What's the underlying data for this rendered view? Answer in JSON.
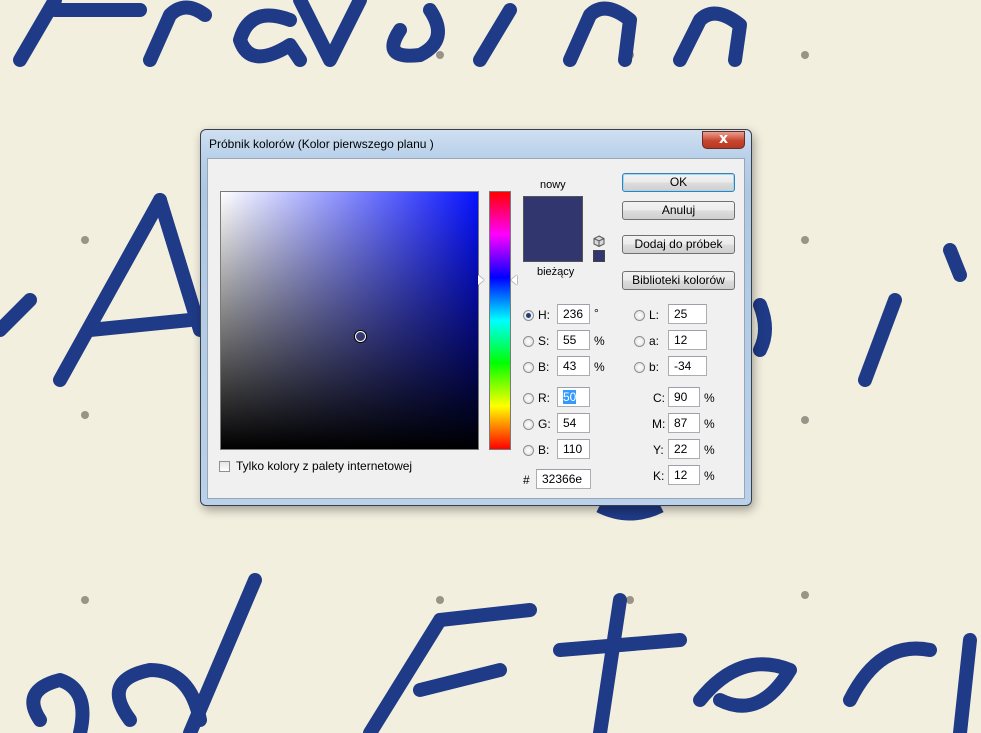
{
  "window": {
    "title": "Próbnik kolorów (Kolor pierwszego planu )",
    "close_glyph": "x"
  },
  "colors": {
    "new": "#32366e",
    "current": "#32366e",
    "field_hue": "#0712ff"
  },
  "swatches": {
    "new_label": "nowy",
    "current_label": "bieżący"
  },
  "buttons": {
    "ok": "OK",
    "cancel": "Anuluj",
    "add_to_swatches": "Dodaj do próbek",
    "color_libraries": "Biblioteki kolorów"
  },
  "web_colors_only": {
    "label": "Tylko kolory z palety internetowej",
    "checked": false
  },
  "hsb": {
    "h": {
      "label": "H:",
      "value": "236",
      "unit": "°",
      "selected": true
    },
    "s": {
      "label": "S:",
      "value": "55",
      "unit": "%",
      "selected": false
    },
    "b": {
      "label": "B:",
      "value": "43",
      "unit": "%",
      "selected": false
    }
  },
  "rgb": {
    "r": {
      "label": "R:",
      "value": "50",
      "selected": false
    },
    "g": {
      "label": "G:",
      "value": "54",
      "selected": false
    },
    "b": {
      "label": "B:",
      "value": "110",
      "selected": false
    }
  },
  "lab": {
    "l": {
      "label": "L:",
      "value": "25",
      "selected": false
    },
    "a": {
      "label": "a:",
      "value": "12",
      "selected": false
    },
    "b": {
      "label": "b:",
      "value": "-34",
      "selected": false
    }
  },
  "cmyk": {
    "c": {
      "label": "C:",
      "value": "90",
      "unit": "%"
    },
    "m": {
      "label": "M:",
      "value": "87",
      "unit": "%"
    },
    "y": {
      "label": "Y:",
      "value": "22",
      "unit": "%"
    },
    "k": {
      "label": "K:",
      "value": "12",
      "unit": "%"
    }
  },
  "hex": {
    "label": "#",
    "value": "32366e"
  }
}
